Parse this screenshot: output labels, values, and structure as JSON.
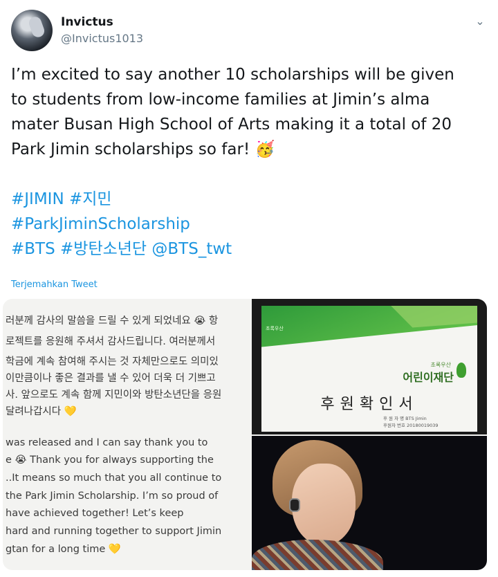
{
  "tweet": {
    "author_name": "Invictus",
    "author_handle": "@Invictus1013",
    "text_lines": [
      "I’m excited to say another 10 scholarships will be given",
      "to students from low-income families at Jimin’s alma",
      "mater Busan High School of Arts making it a total of 20",
      "Park Jimin scholarships so far! 🥳"
    ],
    "hashtags_line1": [
      "#JIMIN",
      "#지민"
    ],
    "hashtags_line2": [
      "#ParkJiminScholarship"
    ],
    "hashtags_line3": [
      "#BTS",
      "#방탄소년단",
      "@BTS_twt"
    ],
    "translate_label": "Terjemahkan Tweet",
    "menu_icon": "chevron-down-icon"
  },
  "media": {
    "note_lines_ko": [
      "러분께 감사의 말씀을 드릴 수 있게 되었네요 😭 항",
      "로젝트를 응원해 주셔서 감사드립니다. 여러분께서",
      "학금에 계속 참여해 주시는 것 자체만으로도 의미있",
      " 이만큼이나 좋은 결과를 낼 수 있어 더욱 더 기쁘고",
      "사. 앞으로도 계속 함께 지민이와 방탄소년단을 응원",
      " 달려나갑시다 💛"
    ],
    "note_lines_en": [
      " was released and I can say thank you to",
      "e 😭 Thank you for always supporting the",
      "..It means so much that you all continue to",
      "the Park Jimin Scholarship. I’m so proud of",
      " have achieved together! Let’s keep",
      " hard and running together to support Jimin",
      "gtan for a long time 💛"
    ],
    "certificate": {
      "green_tag": "초록우산",
      "org_sub": "초록우산",
      "org_name": "어린이재단",
      "title": "후원확인서",
      "meta_line1": "후 원 자 명        BTS Jimin",
      "meta_line2": "후원자 번호        20180019039"
    },
    "colors": {
      "link": "#1b95e0",
      "certificate_green": "#2f6e22"
    }
  }
}
